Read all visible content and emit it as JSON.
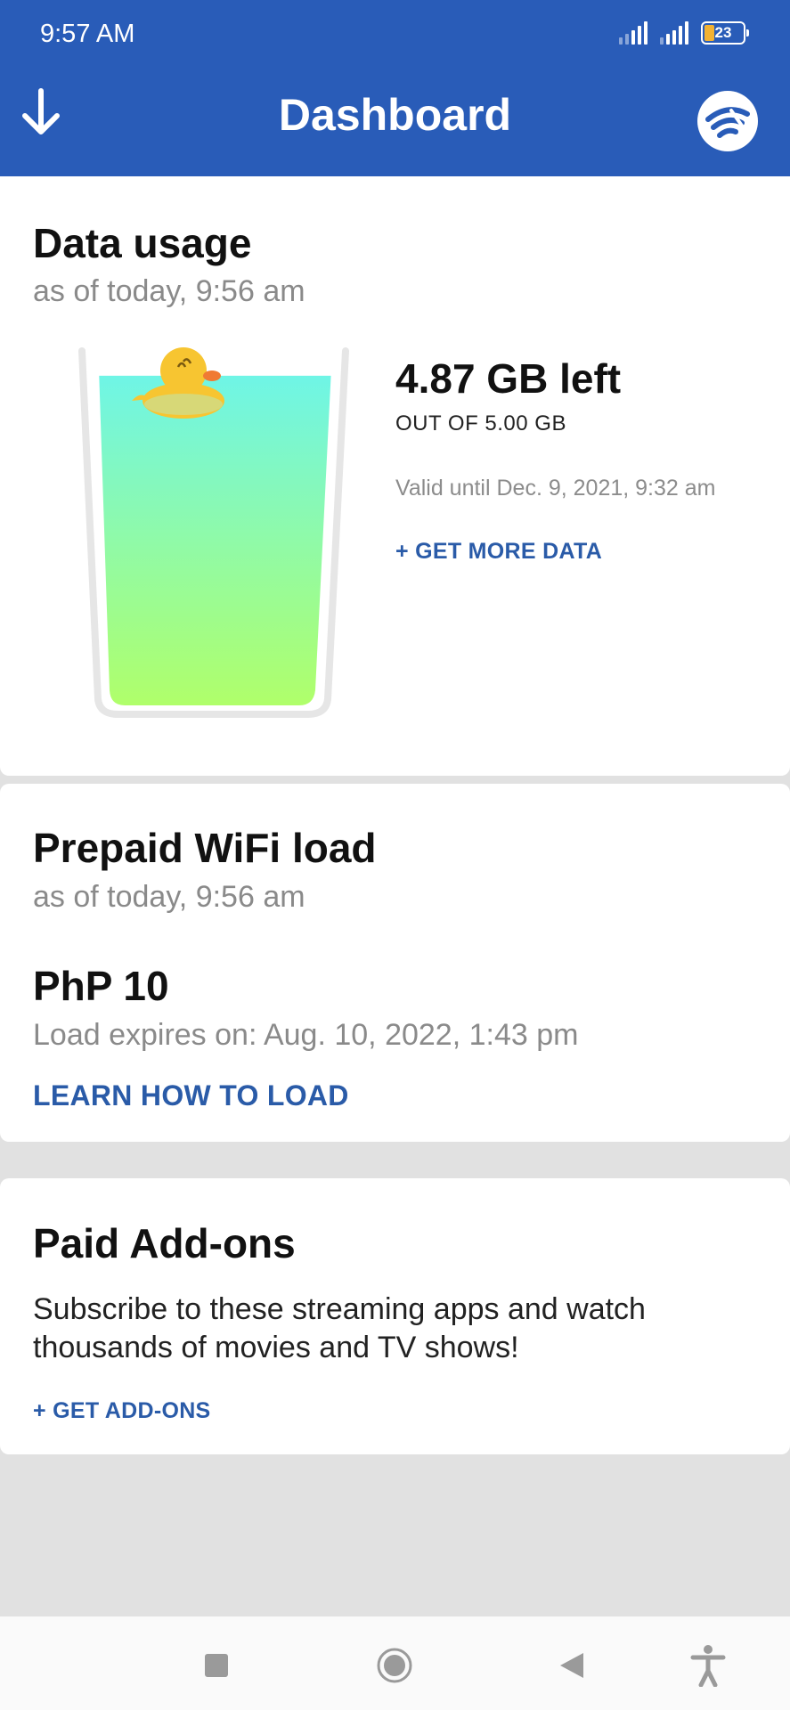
{
  "status_bar": {
    "time": "9:57 AM",
    "battery": "23"
  },
  "header": {
    "title": "Dashboard",
    "back_icon": "down-arrow-icon",
    "brand_icon": "wifi-logo-icon"
  },
  "data_usage": {
    "title": "Data usage",
    "as_of": "as of today, 9:56 am",
    "remaining": "4.87 GB left",
    "total": "OUT OF 5.00 GB",
    "valid_until": "Valid until Dec. 9, 2021, 9:32 am",
    "get_more": "+ GET MORE DATA",
    "fill_fraction": 0.974
  },
  "wifi_load": {
    "title": "Prepaid WiFi load",
    "as_of": "as of today, 9:56 am",
    "balance": "PhP 10",
    "expires": "Load expires on: Aug. 10, 2022, 1:43 pm",
    "learn_link": "LEARN HOW TO LOAD"
  },
  "addons": {
    "title": "Paid Add-ons",
    "description": "Subscribe to these streaming apps and watch thousands of movies and TV shows!",
    "get_link": "+ GET ADD-ONS"
  },
  "colors": {
    "brand": "#295cb8",
    "link": "#2a5ba8",
    "water_top": "#6ff5e6",
    "water_bottom": "#b0ff6a",
    "duck": "#f7c531"
  },
  "nav_bar": {
    "items": [
      "recents-icon",
      "home-icon",
      "back-icon",
      "accessibility-icon"
    ]
  }
}
